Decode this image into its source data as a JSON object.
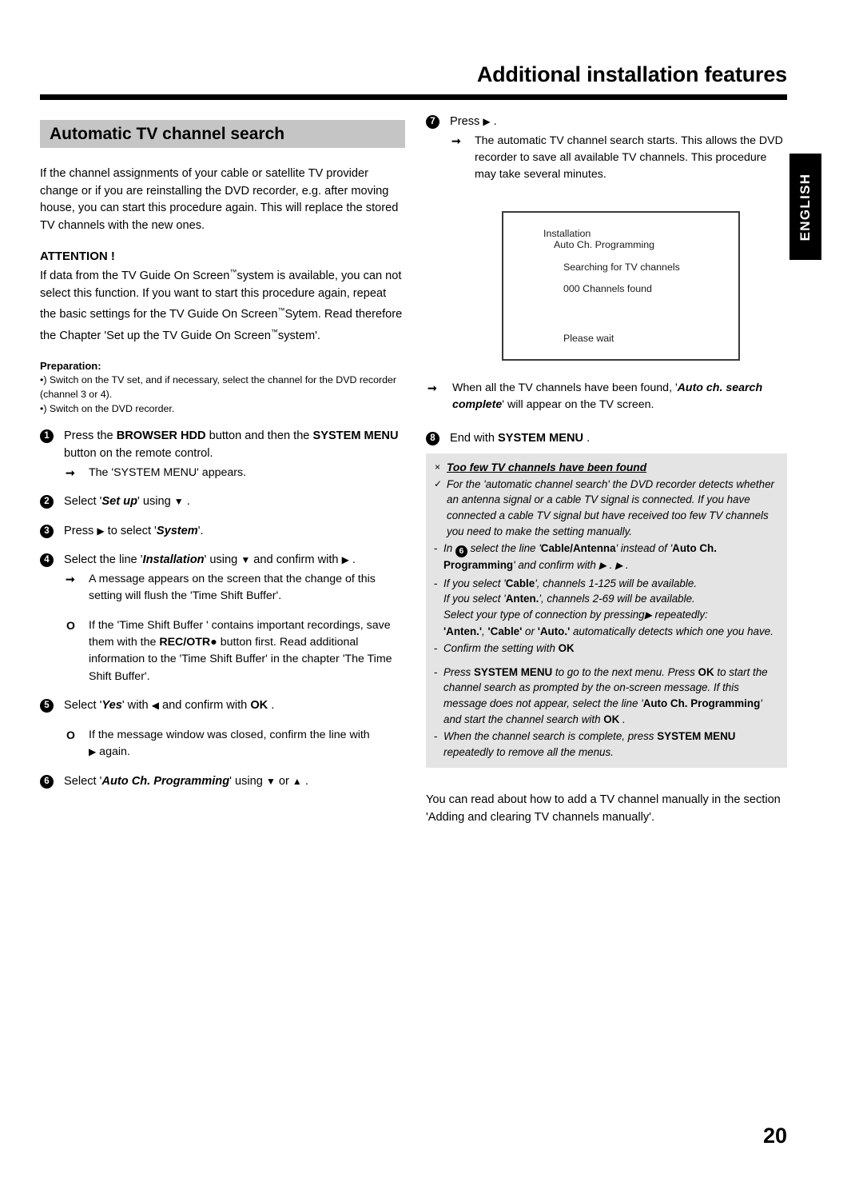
{
  "header": {
    "title": "Additional installation features"
  },
  "lang_tab": {
    "label": "ENGLISH"
  },
  "page_number": "20",
  "left_column": {
    "section_title": "Automatic TV channel search",
    "intro": "If the channel assignments of your cable or satellite TV provider change or if you are reinstalling the DVD recorder, e.g. after moving house, you can start this procedure again. This will replace the stored TV channels with the new ones.",
    "attention_title": "ATTENTION !",
    "attention_body_1": "If data from the TV Guide On Screen",
    "attention_body_2": "system is available, you can not select this function. If you want to start this procedure again, repeat the basic settings for the TV Guide On Screen",
    "attention_body_3": "Sytem. Read therefore the Chapter 'Set up the TV Guide On Screen",
    "attention_body_4": "system'.",
    "tm": "™",
    "preparation_title": "Preparation:",
    "preparation_lines": [
      "•) Switch on the TV set, and if necessary, select the channel for the DVD recorder (channel 3 or 4).",
      "•) Switch on the DVD recorder."
    ],
    "steps": [
      {
        "num": "1",
        "text_a": "Press the ",
        "bold_a": "BROWSER HDD",
        "text_b": " button and then the  ",
        "bold_b": "SYSTEM MENU",
        "text_c": " button on the remote control.",
        "sub_arrow": "The 'SYSTEM MENU' appears."
      },
      {
        "num": "2",
        "text_a": "Select '",
        "bold_a": "Set up",
        "text_b": "' using ",
        "glyph": "▼",
        "text_c": " ."
      },
      {
        "num": "3",
        "text_a": "Press ",
        "glyph": "▶",
        "text_b": " to select '",
        "bold_a": "System",
        "text_c": "'."
      },
      {
        "num": "4",
        "text_a": "Select the line '",
        "bold_a": "Installation",
        "text_b": "' using ",
        "glyph_down": "▼",
        "text_c": " and confirm with ",
        "glyph_right": "▶",
        "text_d": " .",
        "sub_arrow": "A message appears on the screen that the change of this setting will flush the 'Time Shift Buffer'.",
        "sub_circle_a": "If the 'Time Shift Buffer ' contains important recordings, save them with the ",
        "sub_circle_bold": "REC/OTR",
        "sub_circle_dot": "●",
        "sub_circle_b": " button first. Read additional information to the 'Time Shift Buffer' in the chapter 'The Time Shift Buffer'."
      },
      {
        "num": "5",
        "text_a": "Select '",
        "bold_a": "Yes",
        "text_b": "' with ",
        "glyph": "◀",
        "text_c": " and confirm with  ",
        "bold_b": "OK",
        "text_d": " .",
        "sub_circle_a": "If the message window was closed, confirm the line with ",
        "sub_circle_glyph": "▶",
        "sub_circle_b": " again."
      },
      {
        "num": "6",
        "text_a": "Select '",
        "bold_a": "Auto Ch. Programming",
        "text_b": "' using ",
        "glyph_down": "▼",
        "text_c": " or ",
        "glyph_up": "▲",
        "text_d": " ."
      }
    ]
  },
  "right_column": {
    "step7": {
      "num": "7",
      "text_a": "Press ",
      "glyph": "▶",
      "text_b": " .",
      "sub_arrow": "The automatic TV channel search starts. This allows the DVD recorder to save all available TV channels. This procedure may take several minutes."
    },
    "tv_screen": {
      "line1": "Installation",
      "line2": "Auto Ch. Programming",
      "line3": "Searching for TV channels",
      "line4": "000 Channels found",
      "line5": "Please wait"
    },
    "after_screen_arrow_a": "When all the TV channels have been found, '",
    "after_screen_bold": "Auto ch. search complete",
    "after_screen_arrow_b": "' will appear on the TV screen.",
    "step8": {
      "num": "8",
      "text_a": "End with  ",
      "bold_a": "SYSTEM MENU",
      "text_b": " ."
    },
    "tip": {
      "x_mark": "×",
      "check_mark": "✓",
      "heading": "Too few TV channels have been found",
      "body": "For the 'automatic channel search' the DVD recorder detects whether an antenna signal or a cable TV signal is connected. If you have connected a cable TV signal but have received too few TV channels you need to make the setting manually.",
      "item1_a": "In ",
      "item1_num": "6",
      "item1_b": " select the line '",
      "item1_bold1": "Cable/Antenna",
      "item1_c": "' instead of '",
      "item1_bold2": "Auto Ch. Programming",
      "item1_d": "' and confirm with ",
      "item1_glyph": "▶",
      "item1_e": " . ",
      "item1_glyph2": "▶",
      "item1_f": " .",
      "item2_a": "If you select '",
      "item2_bold1": "Cable",
      "item2_b": "', channels 1-125 will be available.",
      "item2_c": "If you select '",
      "item2_bold2": "Anten.",
      "item2_d": "', channels 2-69 will be available.",
      "item2_e": "Select your type of connection by pressing",
      "item2_glyph": "▶",
      "item2_f": " repeatedly:",
      "item2_bold3": "'Anten.'",
      "item2_g": ", ",
      "item2_bold4": "'Cable'",
      "item2_h": " or ",
      "item2_bold5": "'Auto.'",
      "item2_i": " automatically detects which one you have.",
      "item3_a": "Confirm the setting with  ",
      "item3_bold": "OK",
      "item4_a": "Press  ",
      "item4_bold1": "SYSTEM MENU",
      "item4_b": " to go to the next menu. Press  ",
      "item4_bold2": "OK",
      "item4_c": " to start the channel search as prompted by the on-screen message. If this message does not appear, select the line '",
      "item4_bold3": "Auto Ch. Programming",
      "item4_d": "' and start the channel search with  ",
      "item4_bold4": "OK",
      "item4_e": " .",
      "item5_a": "When the channel search is complete, press  ",
      "item5_bold": "SYSTEM MENU",
      "item5_b": " repeatedly to remove all the menus."
    },
    "closing": "You can read about how to add a TV channel manually in the section 'Adding and clearing TV channels manually'."
  },
  "colors": {
    "banner_gray": "#c5c5c5",
    "tip_gray": "#e4e4e4",
    "rule_black": "#000000",
    "tab_black": "#000000"
  }
}
